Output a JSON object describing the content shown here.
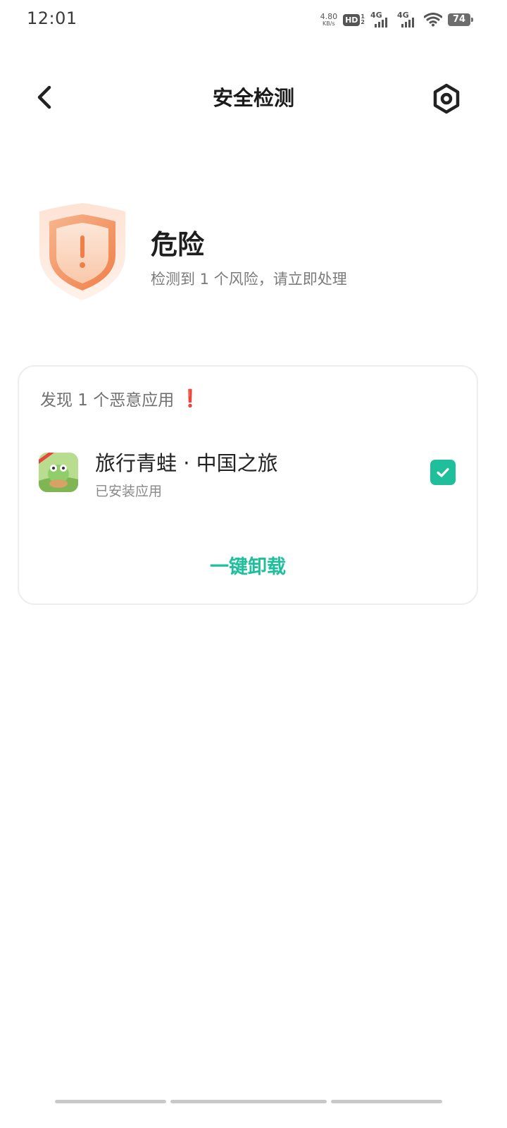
{
  "status_bar": {
    "time": "12:01",
    "net_speed_value": "4.80",
    "net_speed_unit": "KB/s",
    "hd_label": "HD",
    "hd_sub_top": "1",
    "hd_sub_bottom": "2",
    "sim1_label": "4G",
    "sim2_label": "4G",
    "battery": "74"
  },
  "header": {
    "title": "安全检测",
    "back_icon": "chevron-left-icon",
    "settings_icon": "settings-hex-icon"
  },
  "summary": {
    "status_title": "危险",
    "status_desc": "检测到 1 个风险，请立即处理",
    "shield_icon": "warning-shield-icon",
    "accent_color": "#f08a55"
  },
  "card": {
    "heading": "发现 1 个恶意应用",
    "warn_glyph": "❗",
    "app": {
      "name": "旅行青蛙 · 中国之旅",
      "sub": "已安装应用",
      "checked": true
    },
    "action_label": "一键卸载",
    "action_color": "#1fbf9c"
  }
}
